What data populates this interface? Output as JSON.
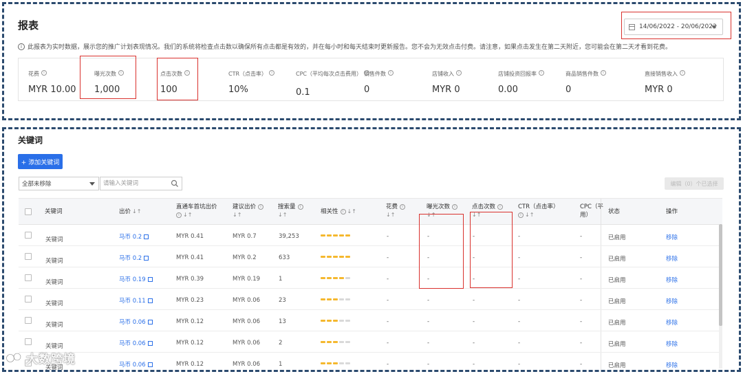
{
  "report": {
    "title": "报表",
    "date_range": "14/06/2022 - 20/06/2022",
    "notice": "此报表为实时数据，展示您的推广计划表现情况。我们的系统将检查点击数以确保所有点击都是有效的，并在每小时和每天结束时更新报告。您不会为无效点击付费。请注意，如果点击发生在第二天附近，您可能会在第二天才看到花费。",
    "metrics": [
      {
        "label": "花费",
        "value": "MYR 10.00"
      },
      {
        "label": "曝光次数",
        "value": "1,000"
      },
      {
        "label": "点击次数",
        "value": "100"
      },
      {
        "label": "CTR（点击率）",
        "value": "10%"
      },
      {
        "label": "CPC（平均每次点击费用）",
        "value": "0.1"
      },
      {
        "label": "销售件数",
        "value": "0"
      },
      {
        "label": "店铺收入",
        "value": "MYR 0"
      },
      {
        "label": "店铺投资回报率",
        "value": "0.00"
      },
      {
        "label": "商品销售件数",
        "value": "0"
      },
      {
        "label": "直接销售收入",
        "value": "MYR 0"
      }
    ]
  },
  "keywords": {
    "title": "关键词",
    "add_button": "+ 添加关键词",
    "filter_value": "全部未移除",
    "search_placeholder": "请输入关键词",
    "edit_button": "编辑（0）个已选择",
    "columns": [
      "关键词",
      "出价",
      "直通车首坑出价",
      "建议出价",
      "搜索量",
      "相关性",
      "花费",
      "曝光次数",
      "点击次数",
      "CTR（点击率）",
      "CPC（平均每次点击费用）",
      "状态",
      "操作"
    ],
    "column_display": {
      "bid": "出价",
      "top_bid_line1": "直通车首坑出价",
      "sugg_bid": "建议出价",
      "search_vol": "搜索量",
      "relevance": "相关性",
      "spend": "花费",
      "impressions": "曝光次数",
      "clicks": "点击次数",
      "ctr": "CTR（点击率）",
      "cpc_line1": "CPC（平",
      "cpc_line2": "用）",
      "status": "状态",
      "action": "操作",
      "keyword": "关键词"
    },
    "rows": [
      {
        "keyword": "关键词",
        "bid": "马币 0.2",
        "top_bid": "MYR 0.41",
        "sugg_bid": "MYR 0.7",
        "search_vol": "39,253",
        "relevance": 5,
        "spend": "-",
        "impressions": "-",
        "clicks": "-",
        "ctr": "-",
        "cpc": "-",
        "status": "已启用",
        "action": "移除"
      },
      {
        "keyword": "关键词",
        "bid": "马币 0.2",
        "top_bid": "MYR 0.41",
        "sugg_bid": "MYR 0.2",
        "search_vol": "633",
        "relevance": 5,
        "spend": "-",
        "impressions": "-",
        "clicks": "-",
        "ctr": "-",
        "cpc": "-",
        "status": "已启用",
        "action": "移除"
      },
      {
        "keyword": "关键词",
        "bid": "马币 0.19",
        "top_bid": "MYR 0.39",
        "sugg_bid": "MYR 0.19",
        "search_vol": "1",
        "relevance": 4,
        "spend": "-",
        "impressions": "-",
        "clicks": "-",
        "ctr": "-",
        "cpc": "-",
        "status": "已启用",
        "action": "移除"
      },
      {
        "keyword": "关键词",
        "bid": "马币 0.11",
        "top_bid": "MYR 0.23",
        "sugg_bid": "MYR 0.06",
        "search_vol": "23",
        "relevance": 3,
        "spend": "-",
        "impressions": "-",
        "clicks": "-",
        "ctr": "-",
        "cpc": "-",
        "status": "已启用",
        "action": "移除"
      },
      {
        "keyword": "关键词",
        "bid": "马币 0.06",
        "top_bid": "MYR 0.12",
        "sugg_bid": "MYR 0.06",
        "search_vol": "13",
        "relevance": 3,
        "spend": "-",
        "impressions": "-",
        "clicks": "-",
        "ctr": "-",
        "cpc": "-",
        "status": "已启用",
        "action": "移除"
      },
      {
        "keyword": "关键词",
        "bid": "马币 0.06",
        "top_bid": "MYR 0.12",
        "sugg_bid": "MYR 0.06",
        "search_vol": "2",
        "relevance": 3,
        "spend": "-",
        "impressions": "-",
        "clicks": "-",
        "ctr": "-",
        "cpc": "-",
        "status": "已启用",
        "action": "移除"
      },
      {
        "keyword": "关键词",
        "bid": "马币 0.06",
        "top_bid": "MYR 0.12",
        "sugg_bid": "MYR 0.06",
        "search_vol": "1",
        "relevance": 3,
        "spend": "-",
        "impressions": "-",
        "clicks": "-",
        "ctr": "-",
        "cpc": "-",
        "status": "已启用",
        "action": "移除"
      }
    ]
  },
  "watermark": "大数跨境",
  "colors": {
    "accent": "#2a6fe8",
    "relevance_on": "#f5b82e",
    "relevance_off": "#d9d9d9",
    "highlight": "#d9302c",
    "frame": "#2b4a6e"
  }
}
